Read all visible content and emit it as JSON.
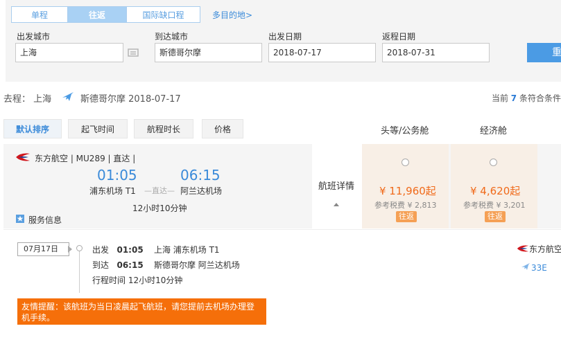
{
  "search": {
    "trip_tabs": [
      "单程",
      "往返",
      "国际缺口程"
    ],
    "multi_city": "多目的地>",
    "from_label": "出发城市",
    "from_value": "上海",
    "to_label": "到达城市",
    "to_value": "斯德哥尔摩",
    "depart_label": "出发日期",
    "depart_value": "2018-07-17",
    "return_label": "返程日期",
    "return_value": "2018-07-31",
    "search_button": "重"
  },
  "segment": {
    "label": "去程： 上海",
    "dest": "斯德哥尔摩 2018-07-17",
    "count_prefix": "当前",
    "count_num": "7",
    "count_suffix": "条符合条件"
  },
  "sort": [
    "默认排序",
    "起飞时间",
    "航程时长",
    "价格"
  ],
  "cabins": [
    "头等/公务舱",
    "经济舱"
  ],
  "flight": {
    "airline_line": "东方航空 |  MU289 |  直达  |",
    "dep_time": "01:05",
    "arr_time": "06:15",
    "dep_airport": "浦东机场 T1",
    "direct": "—直达—",
    "arr_airport": "阿兰达机场",
    "duration": "12小时10分钟",
    "service": "服务信息",
    "details": "航班详情",
    "fares": [
      {
        "price": "¥ 11,960起",
        "tax": "参考税费 ¥ 2,813",
        "badge": "往返"
      },
      {
        "price": "¥ 4,620起",
        "tax": "参考税费 ¥ 3,201",
        "badge": "往返"
      }
    ]
  },
  "detail": {
    "date": "07月17日",
    "depart_label": "出发",
    "depart_time": "01:05",
    "depart_place": "上海   浦东机场 T1",
    "arrive_label": "到达",
    "arrive_time": "06:15",
    "arrive_place": "斯德哥尔摩   阿兰达机场",
    "duration_text": "行程时间  12小时10分钟",
    "airline": "东方航空",
    "aircraft": "33E",
    "notice": "友情提醒：该航班为当日凌晨起飞航班，请您提前去机场办理登机手续。"
  },
  "colors": {
    "accent": "#3a8ad9",
    "price": "#f06a1a",
    "notice_bg": "#f56f0a"
  }
}
